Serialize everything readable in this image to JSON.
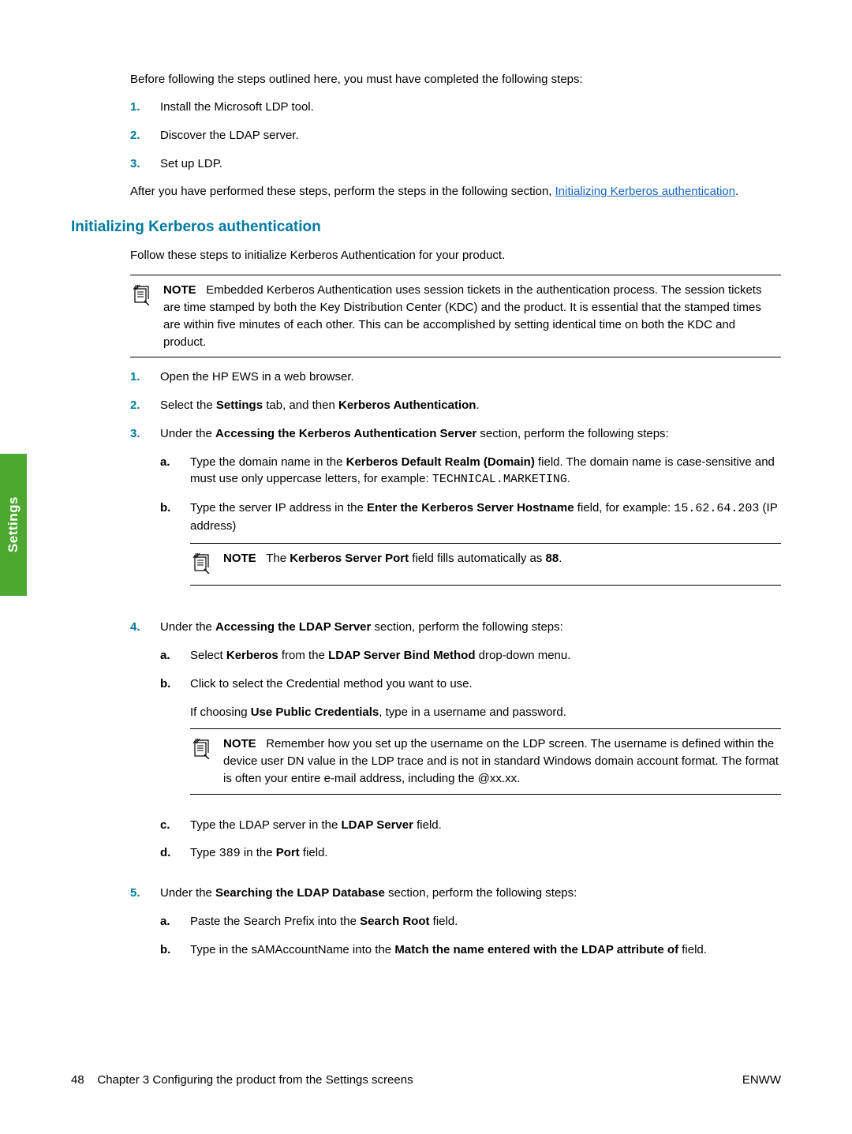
{
  "side_tab": "Settings",
  "intro": "Before following the steps outlined here, you must have completed the following steps:",
  "steps_pre": [
    "Install the Microsoft LDP tool.",
    "Discover the LDAP server.",
    "Set up LDP."
  ],
  "after_text_1": "After you have performed these steps, perform the steps in the following section, ",
  "after_link": "Initializing Kerberos authentication",
  "after_text_2": ".",
  "heading": "Initializing Kerberos authentication",
  "heading_intro": "Follow these steps to initialize Kerberos Authentication for your product.",
  "note1_label": "NOTE",
  "note1_text": "Embedded Kerberos Authentication uses session tickets in the authentication process. The session tickets are time stamped by both the Key Distribution Center (KDC) and the product. It is essential that the stamped times are within five minutes of each other. This can be accomplished by setting identical time on both the KDC and product.",
  "s1": {
    "num": "1.",
    "text": "Open the HP EWS in a web browser."
  },
  "s2": {
    "num": "2.",
    "pre": "Select the ",
    "b1": "Settings",
    "mid": " tab, and then ",
    "b2": "Kerberos Authentication",
    "post": "."
  },
  "s3": {
    "num": "3.",
    "pre": "Under the ",
    "b1": "Accessing the Kerberos Authentication Server",
    "post": " section, perform the following steps:",
    "a": {
      "letter": "a.",
      "t1": "Type the domain name in the ",
      "b1": "Kerberos Default Realm (Domain)",
      "t2": " field. The domain name is case-sensitive and must use only uppercase letters, for example: ",
      "code": "TECHNICAL.MARKETING",
      "t3": "."
    },
    "b": {
      "letter": "b.",
      "t1": "Type the server IP address in the ",
      "b1": "Enter the Kerberos Server Hostname",
      "t2": " field, for example: ",
      "code": "15.62.64.203",
      "t3": " (IP address)"
    },
    "note": {
      "label": "NOTE",
      "t1": "The ",
      "b1": "Kerberos Server Port",
      "t2": " field fills automatically as ",
      "b2": "88",
      "t3": "."
    }
  },
  "s4": {
    "num": "4.",
    "pre": "Under the ",
    "b1": "Accessing the LDAP Server",
    "post": " section, perform the following steps:",
    "a": {
      "letter": "a.",
      "t1": "Select ",
      "b1": "Kerberos",
      "t2": " from the ",
      "b2": "LDAP Server Bind Method",
      "t3": " drop-down menu."
    },
    "b": {
      "letter": "b.",
      "text": "Click to select the Credential method you want to use.",
      "para_t1": "If choosing ",
      "para_b1": "Use Public Credentials",
      "para_t2": ", type in a username and password."
    },
    "note": {
      "label": "NOTE",
      "text": "Remember how you set up the username on the LDP screen. The username is defined within the device user DN value in the LDP trace and is not in standard Windows domain account format. The format is often your entire e-mail address, including the @xx.xx."
    },
    "c": {
      "letter": "c.",
      "t1": "Type the LDAP server in the ",
      "b1": "LDAP Server",
      "t2": " field."
    },
    "d": {
      "letter": "d.",
      "t1": "Type ",
      "code": "389",
      "t2": " in the ",
      "b1": "Port",
      "t3": " field."
    }
  },
  "s5": {
    "num": "5.",
    "pre": "Under the ",
    "b1": "Searching the LDAP Database",
    "post": " section, perform the following steps:",
    "a": {
      "letter": "a.",
      "t1": "Paste the Search Prefix into the ",
      "b1": "Search Root",
      "t2": " field."
    },
    "b": {
      "letter": "b.",
      "t1": "Type in the sAMAccountName into the ",
      "b1": "Match the name entered with the LDAP attribute of",
      "t2": " field."
    }
  },
  "footer": {
    "page": "48",
    "chapter": "Chapter 3   Configuring the product from the Settings screens",
    "right": "ENWW"
  }
}
